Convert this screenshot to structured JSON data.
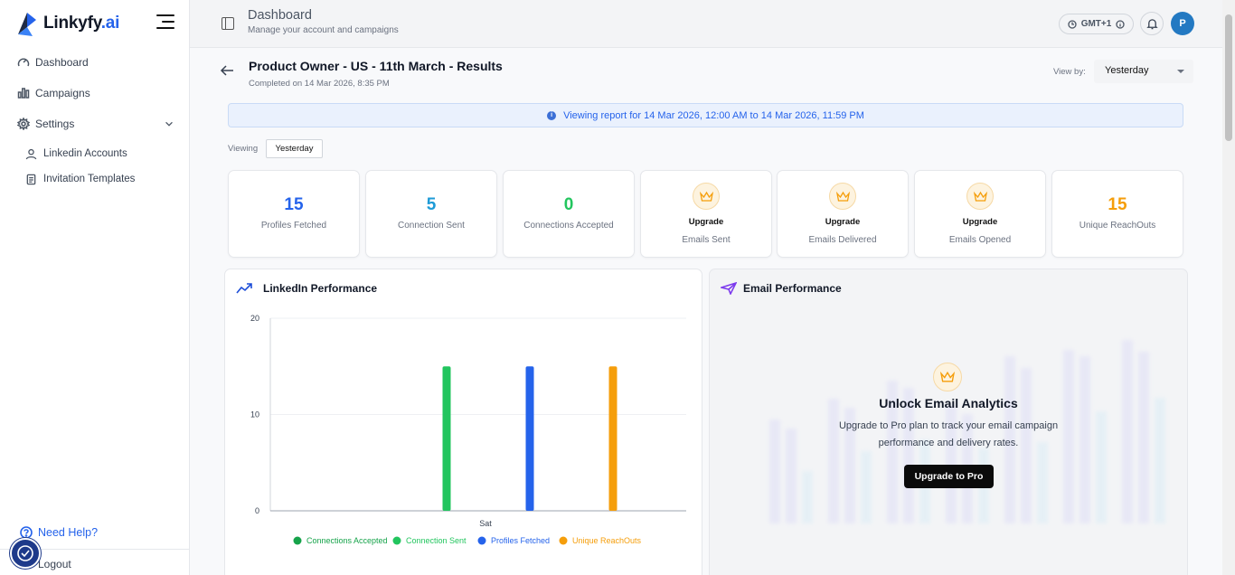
{
  "sidebar": {
    "brand": "Linkyfy",
    "brand_suffix": ".ai",
    "items": [
      {
        "label": "Dashboard",
        "icon": "dashboard-icon"
      },
      {
        "label": "Campaigns",
        "icon": "bar-chart-icon"
      },
      {
        "label": "Settings",
        "icon": "gear-icon"
      }
    ],
    "sub_items": [
      {
        "label": "Linkedin Accounts",
        "icon": "user-icon"
      },
      {
        "label": "Invitation Templates",
        "icon": "document-icon"
      }
    ],
    "help": "Need Help?",
    "logout": "Logout"
  },
  "header": {
    "title": "Dashboard",
    "subtitle": "Manage your account and campaigns",
    "timezone": "GMT+1",
    "avatar_initial": "P"
  },
  "report": {
    "title": "Product Owner - US - 11th March - Results",
    "completed": "Completed on 14 Mar 2026, 8:35 PM",
    "view_by_label": "View by:",
    "view_by_value": "Yesterday",
    "banner": "Viewing report for 14 Mar 2026, 12:00 AM to 14 Mar 2026, 11:59 PM",
    "viewing_label": "Viewing",
    "viewing_value": "Yesterday"
  },
  "stats": [
    {
      "value": "15",
      "label": "Profiles Fetched",
      "color": "#2563eb"
    },
    {
      "value": "5",
      "label": "Connection Sent",
      "color": "#1e9bd7"
    },
    {
      "value": "0",
      "label": "Connections Accepted",
      "color": "#22c55e"
    },
    {
      "upgrade": "Upgrade",
      "label": "Emails Sent"
    },
    {
      "upgrade": "Upgrade",
      "label": "Emails Delivered"
    },
    {
      "upgrade": "Upgrade",
      "label": "Emails Opened"
    },
    {
      "value": "15",
      "label": "Unique ReachOuts",
      "color": "#f59e0b"
    }
  ],
  "linkedin_card": {
    "title": "LinkedIn Performance"
  },
  "email_card": {
    "title": "Email Performance",
    "lock_title": "Unlock Email Analytics",
    "lock_text": "Upgrade to Pro plan to track your email campaign performance and delivery rates.",
    "lock_button": "Upgrade to Pro"
  },
  "chart_data": {
    "type": "bar",
    "categories": [
      "Sat"
    ],
    "series": [
      {
        "name": "Connections Accepted",
        "values": [
          0
        ],
        "color": "#16a34a"
      },
      {
        "name": "Connection Sent",
        "values": [
          15
        ],
        "color": "#22c55e"
      },
      {
        "name": "Profiles Fetched",
        "values": [
          15
        ],
        "color": "#2563eb"
      },
      {
        "name": "Unique ReachOuts",
        "values": [
          15
        ],
        "color": "#f59e0b"
      }
    ],
    "yticks": [
      "0",
      "10",
      "20"
    ],
    "ylim": [
      0,
      20
    ],
    "grid": true,
    "legend": "bottom"
  }
}
